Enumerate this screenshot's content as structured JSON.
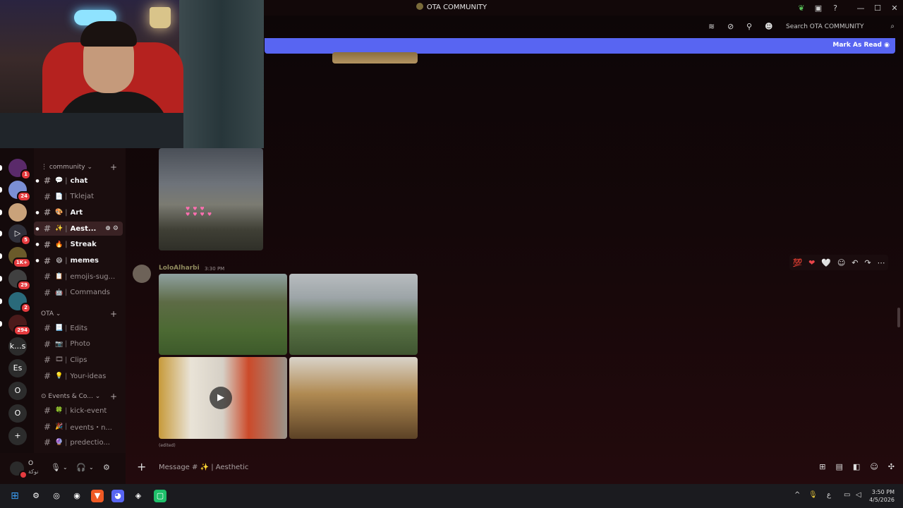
{
  "window": {
    "title": "OTA COMMUNITY",
    "minimize": "—",
    "maximize": "☐",
    "close": "✕"
  },
  "title_icons": [
    "leaf-icon",
    "inbox-icon",
    "help-icon"
  ],
  "servers": [
    {
      "badge": "1",
      "color": "#5a2a6a",
      "label": ""
    },
    {
      "badge": "24",
      "color": "#7b8fd4",
      "label": ""
    },
    {
      "badge": "",
      "color": "#c9a27a",
      "label": ""
    },
    {
      "badge": "5",
      "color": "#30303a",
      "label": "▷"
    },
    {
      "badge": "1K+",
      "color": "#6a5a2a",
      "label": ""
    },
    {
      "badge": "29",
      "color": "#404040",
      "label": ""
    },
    {
      "badge": "2",
      "color": "#2a6a7a",
      "label": ""
    },
    {
      "badge": "294",
      "color": "#4a1a1a",
      "label": ""
    },
    {
      "badge": "",
      "color": "#2c2c2c",
      "label": "k...s"
    },
    {
      "badge": "",
      "color": "#2c2c2c",
      "label": "Es"
    },
    {
      "badge": "",
      "color": "#2c2c2c",
      "label": "O"
    },
    {
      "badge": "",
      "color": "#2c2c2c",
      "label": "O"
    },
    {
      "badge": "",
      "color": "#2c2c2c",
      "label": "+"
    }
  ],
  "categories": {
    "community": "community",
    "ota": "OTA",
    "events": "Events & Co..."
  },
  "channels": {
    "community": [
      {
        "emoji": "💬",
        "name": "chat",
        "unread": true
      },
      {
        "emoji": "📄",
        "name": "Tklejat",
        "unread": false
      },
      {
        "emoji": "🎨",
        "name": "Art",
        "unread": true
      },
      {
        "emoji": "✨",
        "name": "Aest...",
        "unread": true,
        "active": true
      },
      {
        "emoji": "🔥",
        "name": "Streak",
        "unread": true
      },
      {
        "emoji": "😄",
        "name": "memes",
        "unread": true
      },
      {
        "emoji": "📋",
        "name": "emojis-sug...",
        "unread": false
      },
      {
        "emoji": "🤖",
        "name": "Commands",
        "unread": false
      }
    ],
    "ota": [
      {
        "emoji": "📃",
        "name": "Edits"
      },
      {
        "emoji": "📷",
        "name": "Photo"
      },
      {
        "emoji": "🎞",
        "name": "Clips"
      },
      {
        "emoji": "💡",
        "name": "Your-ideas"
      }
    ],
    "events": [
      {
        "emoji": "🍀",
        "name": "kick-event"
      },
      {
        "emoji": "🎉",
        "name": "events・n..."
      },
      {
        "emoji": "🔮",
        "name": "predectio..."
      }
    ]
  },
  "user": {
    "name": "O",
    "subtitle": "نوكة"
  },
  "search": {
    "placeholder": "Search OTA COMMUNITY"
  },
  "banner": {
    "mark_read": "Mark As Read"
  },
  "message": {
    "author": "LoloAlharbi",
    "time": "3:30 PM",
    "edited": "(edited)"
  },
  "reactions": [
    "💯",
    "❤",
    "🤍",
    "☺",
    "↶",
    "↷",
    "⋯"
  ],
  "composer": {
    "placeholder": "Message # ✨ | Aesthetic"
  },
  "taskbar": {
    "time": "3:50 PM",
    "date": "4/5/2026",
    "lang": "ع"
  },
  "colors": {
    "accent": "#5865f2",
    "background": "#140709",
    "notification": "#e53b3f"
  }
}
